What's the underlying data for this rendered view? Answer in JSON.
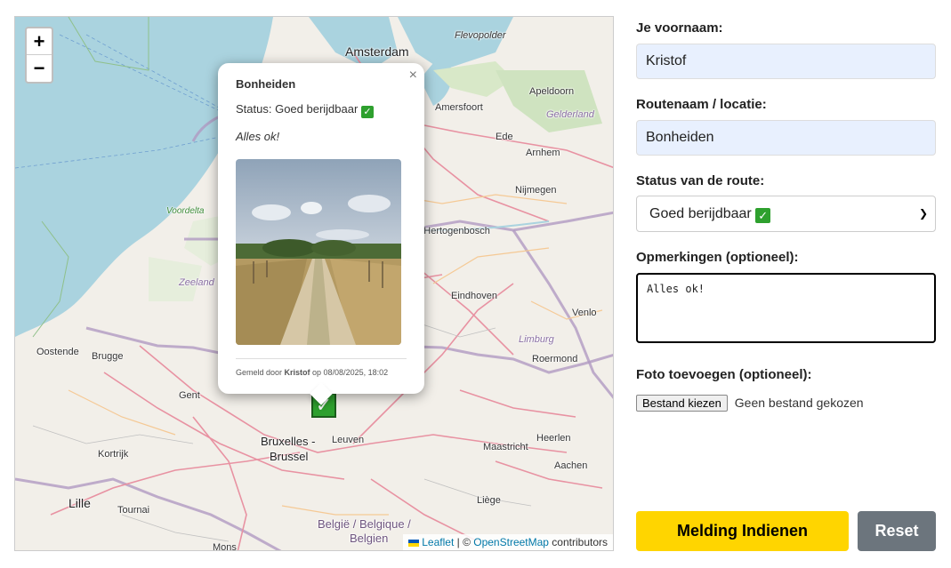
{
  "map": {
    "zoom_in": "+",
    "zoom_out": "−",
    "cities": {
      "amsterdam": "Amsterdam",
      "flevopolder": "Flevopolder",
      "apeldoorn": "Apeldoorn",
      "amersfoort": "Amersfoort",
      "gelderland": "Gelderland",
      "ede": "Ede",
      "arnhem": "Arnhem",
      "nijmegen": "Nijmegen",
      "hertogenbosch": "'s-Hertogenbosch",
      "eindhoven": "Eindhoven",
      "venlo": "Venlo",
      "limburg": "Limburg",
      "roermond": "Roermond",
      "voordelta": "Voordelta",
      "zeeland": "Zeeland",
      "oostende": "Oostende",
      "brugge": "Brugge",
      "gent": "Gent",
      "bruxelles": "Bruxelles -",
      "brussel": "Brussel",
      "leuven": "Leuven",
      "maastricht": "Maastricht",
      "heerlen": "Heerlen",
      "aachen": "Aachen",
      "kortrijk": "Kortrijk",
      "lille": "Lille",
      "tournai": "Tournai",
      "liege": "Liège",
      "mons": "Mons",
      "belgie": "België / Belgique /",
      "belgien": "Belgien"
    },
    "attribution": {
      "leaflet": "Leaflet",
      "sep": " | © ",
      "osm": "OpenStreetMap",
      "contributors": " contributors"
    }
  },
  "popup": {
    "close": "×",
    "title": "Bonheiden",
    "status_label": "Status: Goed berijdbaar",
    "status_icon": "✓",
    "remark": "Alles ok!",
    "footer_prefix": "Gemeld door ",
    "footer_name": "Kristof",
    "footer_suffix": " op 08/08/2025, 18:02"
  },
  "marker": {
    "icon": "✓",
    "color": "#2ea02e"
  },
  "form": {
    "firstname_label": "Je voornaam:",
    "firstname_value": "Kristof",
    "route_label": "Routenaam / locatie:",
    "route_value": "Bonheiden",
    "status_label": "Status van de route:",
    "status_value": "Goed berijdbaar",
    "status_icon": "✓",
    "remarks_label": "Opmerkingen (optioneel):",
    "remarks_value": "Alles ok!",
    "photo_label": "Foto toevoegen (optioneel):",
    "file_button": "Bestand kiezen",
    "file_status": "Geen bestand gekozen",
    "submit": "Melding Indienen",
    "reset": "Reset"
  },
  "colors": {
    "submit": "#ffd500",
    "reset": "#6c757d",
    "field_bg": "#e8f0fe"
  }
}
